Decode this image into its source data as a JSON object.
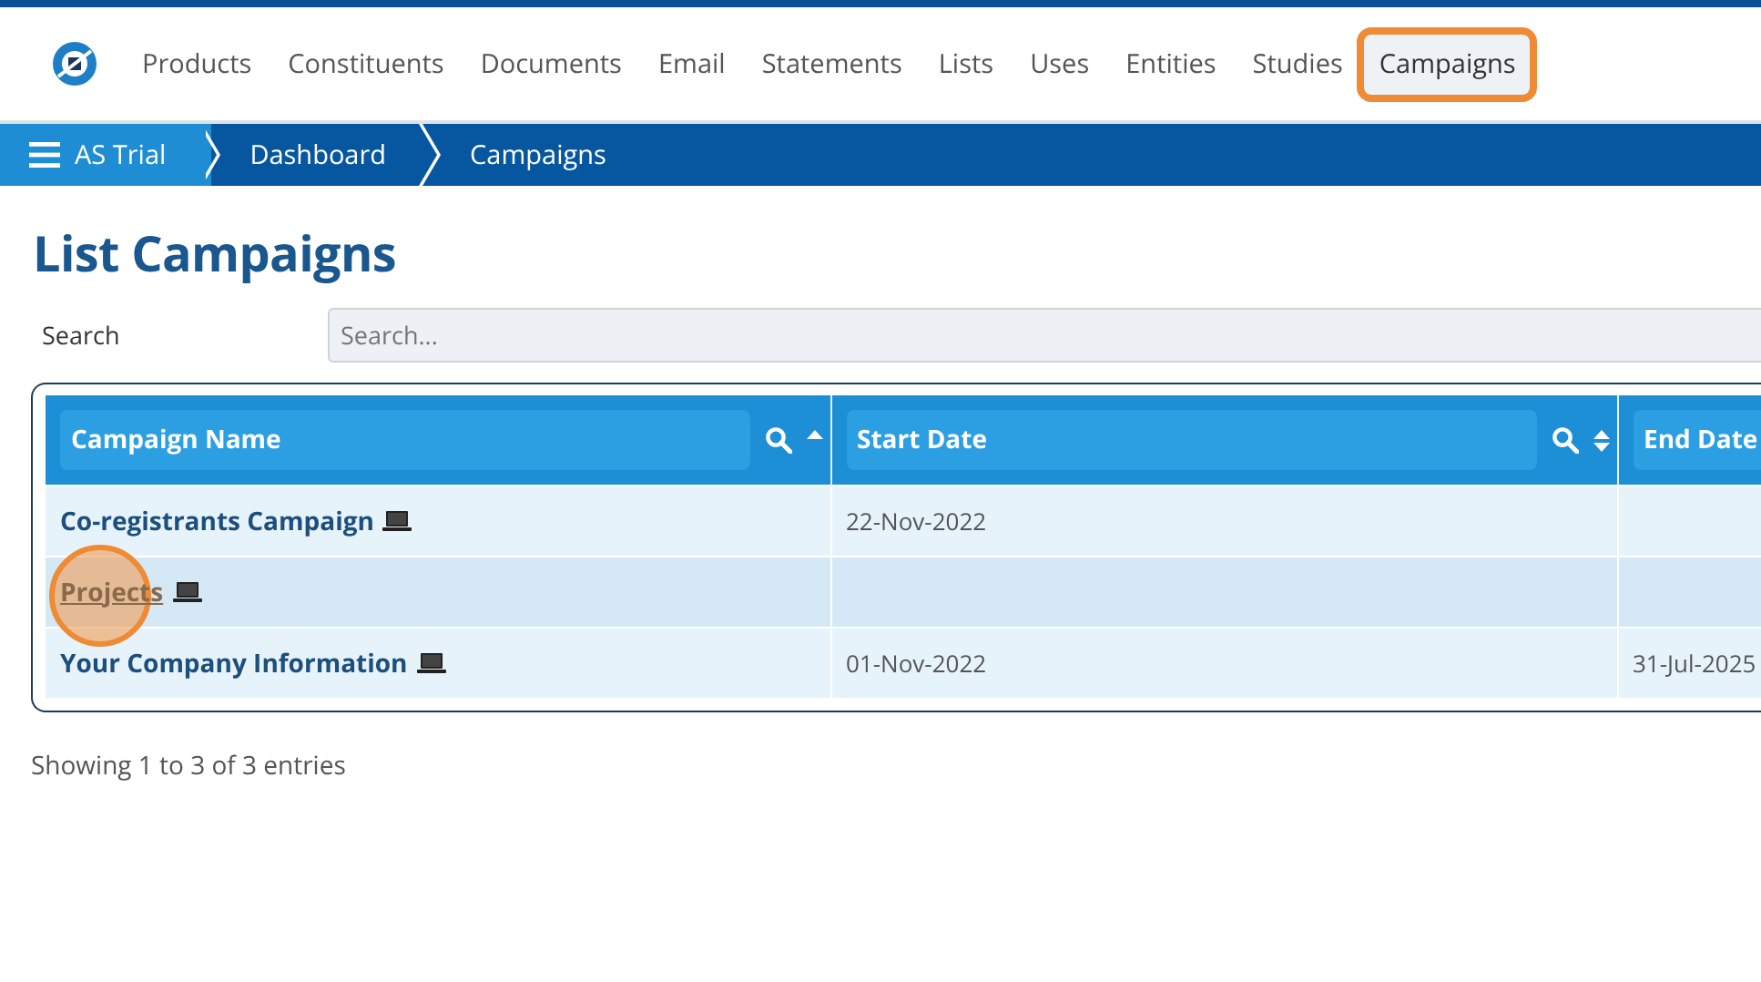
{
  "nav": {
    "items": [
      {
        "label": "Products",
        "selected": false
      },
      {
        "label": "Constituents",
        "selected": false
      },
      {
        "label": "Documents",
        "selected": false
      },
      {
        "label": "Email",
        "selected": false
      },
      {
        "label": "Statements",
        "selected": false
      },
      {
        "label": "Lists",
        "selected": false
      },
      {
        "label": "Uses",
        "selected": false
      },
      {
        "label": "Entities",
        "selected": false
      },
      {
        "label": "Studies",
        "selected": false
      },
      {
        "label": "Campaigns",
        "selected": true
      }
    ]
  },
  "breadcrumb": [
    "AS Trial",
    "Dashboard",
    "Campaigns"
  ],
  "page_title": "List Campaigns",
  "search": {
    "label": "Search",
    "placeholder": "Search..."
  },
  "table": {
    "columns": [
      {
        "label": "Campaign Name",
        "sorted": true
      },
      {
        "label": "Start Date",
        "sorted": false
      },
      {
        "label": "End Date"
      }
    ],
    "rows": [
      {
        "name": "Co-registrants Campaign",
        "start": "22-Nov-2022",
        "end": "",
        "hovered": false
      },
      {
        "name": "Projects",
        "start": "",
        "end": "",
        "hovered": true
      },
      {
        "name": "Your Company Information",
        "start": "01-Nov-2022",
        "end": "31-Jul-2025",
        "hovered": false
      }
    ]
  },
  "footer": "Showing 1 to 3 of 3 entries"
}
